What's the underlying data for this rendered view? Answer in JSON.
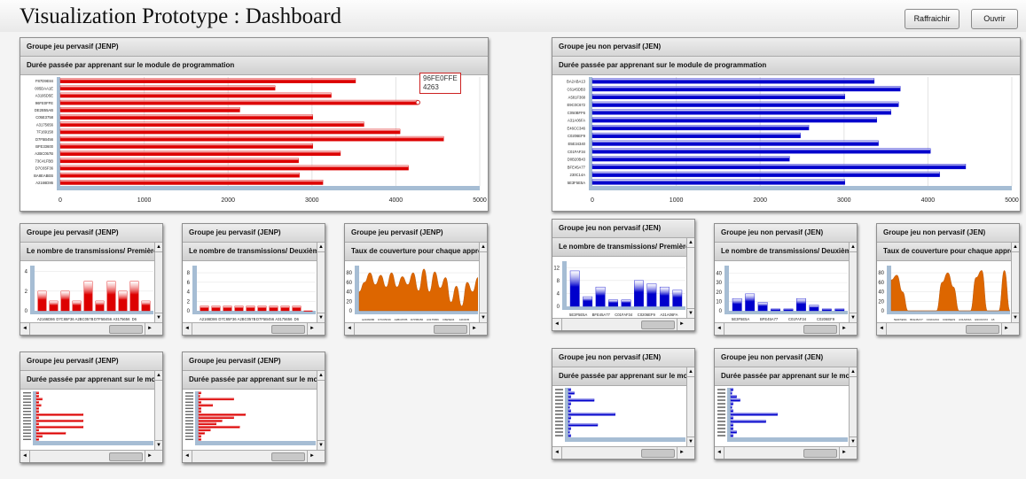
{
  "header": {
    "title": "Visualization Prototype : Dashboard",
    "refresh_label": "Raffraichir",
    "open_label": "Ouvrir"
  },
  "colors": {
    "red": "#dd0000",
    "blue": "#0000cc",
    "orange": "#dd6600",
    "axis": "#a6bdd4"
  },
  "panels": [
    {
      "title": "Groupe jeu pervasif (JENP)",
      "chart_title": "Durée passée par apprenant sur le module de programmation"
    },
    {
      "title": "Groupe jeu non pervasif (JEN)",
      "chart_title": "Durée passée par apprenant sur le module de programmation"
    },
    {
      "title": "Groupe jeu pervasif (JENP)",
      "chart_title": "Le nombre de transmissions/ Première"
    },
    {
      "title": "Groupe jeu pervasif (JENP)",
      "chart_title": "Le nombre de transmissions/ Deuxième"
    },
    {
      "title": "Groupe jeu pervasif (JENP)",
      "chart_title": "Taux de couverture pour chaque appren"
    },
    {
      "title": "Groupe jeu non pervasif (JEN)",
      "chart_title": "Le nombre de transmissions/ Première"
    },
    {
      "title": "Groupe jeu non pervasif (JEN)",
      "chart_title": "Le nombre de transmissions/ Deuxième"
    },
    {
      "title": "Groupe jeu non pervasif (JEN)",
      "chart_title": "Taux de couverture pour chaque appre"
    },
    {
      "title": "Groupe jeu pervasif (JENP)",
      "chart_title": "Durée passée par apprenant sur le mod"
    },
    {
      "title": "Groupe jeu pervasif (JENP)",
      "chart_title": "Durée passée par apprenant sur le mod"
    },
    {
      "title": "Groupe jeu non pervasif (JEN)",
      "chart_title": "Durée passée par apprenant sur le mo"
    },
    {
      "title": "Groupe jeu non pervasif (JEN)",
      "chart_title": "Durée passée par apprenant sur le mo"
    }
  ],
  "tooltip": {
    "line1": "96FE0FFE",
    "line2": "4263"
  },
  "chart_data": [
    {
      "type": "bar",
      "orientation": "horizontal",
      "color": "red",
      "categories": [
        "F87D9E84",
        "005DAA1E",
        "A3195D5E",
        "96FE0FFE",
        "DE2B55AB",
        "C05E3758",
        "A3175656",
        "7F169158",
        "D7F5B456",
        "BFE33600",
        "A2BC057B",
        "73C41FBB",
        "D7C65F36",
        "BA8EABEB",
        "A2166D86"
      ],
      "values": [
        3520,
        2560,
        3230,
        4263,
        2140,
        3010,
        3620,
        4050,
        4570,
        3010,
        3340,
        2840,
        4150,
        2850,
        3130
      ],
      "ticks": [
        0,
        1000,
        2000,
        3000,
        4000,
        5000
      ],
      "xlim": [
        0,
        5000
      ]
    },
    {
      "type": "bar",
      "orientation": "horizontal",
      "color": "blue",
      "categories": [
        "BA2ABA13",
        "C6145DB3",
        "A581F368",
        "E9C0C672",
        "C050BFF6",
        "A31A06FA",
        "E46CC346",
        "C0206EF9",
        "E5E34340",
        "C01FAF34",
        "D0B20B43",
        "BFE45A77",
        "230C14A",
        "5E3F5E5A"
      ],
      "values": [
        3360,
        3670,
        3010,
        3650,
        3560,
        3390,
        2580,
        2480,
        3410,
        4030,
        2350,
        4450,
        4140,
        3010
      ],
      "ticks": [
        0,
        1000,
        2000,
        3000,
        4000,
        5000
      ],
      "xlim": [
        0,
        5000
      ]
    },
    {
      "type": "bar",
      "color": "red",
      "yticks": [
        0,
        2,
        4
      ],
      "ylim": [
        0,
        4.6
      ],
      "xlabels": [
        "A2166D86",
        "D7C65F36",
        "A2BC057B",
        "D7F5B456",
        "A3175656",
        "D6"
      ],
      "values": [
        2,
        1,
        2,
        1,
        3,
        1,
        3,
        2,
        3,
        1
      ]
    },
    {
      "type": "bar",
      "color": "red",
      "yticks": [
        0,
        2,
        4,
        6,
        8
      ],
      "ylim": [
        0,
        9.5
      ],
      "xlabels": [
        "A2166D86",
        "D7C65F36",
        "A2BC057B",
        "D7F5B456",
        "A3175656",
        "D6"
      ],
      "values": [
        1,
        1,
        1,
        1,
        1,
        1,
        1,
        1,
        1,
        0
      ]
    },
    {
      "type": "area",
      "color": "orange",
      "yticks": [
        0,
        20,
        40,
        60,
        80
      ],
      "ylim": [
        0,
        95
      ],
      "xlabels": [
        "A2166D86",
        "D7C65F36",
        "A2BC057B",
        "D7F5B456",
        "A3175656",
        "D6E5E04",
        "A3C0FB"
      ],
      "values": [
        40,
        60,
        80,
        55,
        75,
        50,
        80,
        50,
        72,
        55,
        80,
        42,
        88,
        40,
        82,
        48,
        70,
        18,
        52,
        10,
        60,
        40,
        70
      ]
    },
    {
      "type": "bar",
      "color": "blue",
      "yticks": [
        0,
        4,
        8,
        12
      ],
      "ylim": [
        0,
        14
      ],
      "xlabels": [
        "5E3F5E5A",
        "BFE45A77",
        "C01FAF34",
        "C0206EF9",
        "A31A06FA"
      ],
      "values": [
        11,
        3,
        6,
        2,
        2,
        8,
        7,
        6,
        5
      ]
    },
    {
      "type": "bar",
      "color": "blue",
      "yticks": [
        0,
        10,
        20,
        30,
        40
      ],
      "ylim": [
        0,
        48
      ],
      "xlabels": [
        "5E3F5E5A",
        "BFE45A77",
        "C01FAF34",
        "C0206EF9"
      ],
      "values": [
        13,
        18,
        9,
        2,
        2,
        13,
        6,
        2,
        2
      ]
    },
    {
      "type": "area",
      "color": "orange",
      "yticks": [
        0,
        20,
        40,
        60,
        80
      ],
      "ylim": [
        0,
        95
      ],
      "xlabels": [
        "5E3F5E5A",
        "BFE45A77",
        "C01FAF34",
        "C0206EF9",
        "A31A06FA",
        "E9C0C672",
        "A5"
      ],
      "values": [
        65,
        75,
        40,
        0,
        0,
        0,
        0,
        0,
        0,
        60,
        80,
        50,
        0,
        0,
        0,
        70,
        85,
        0,
        0,
        0,
        85,
        0
      ]
    },
    {
      "type": "bar",
      "orientation": "horizontal",
      "color": "red",
      "values": [
        0.02,
        0.02,
        0.05,
        0.02,
        0.04,
        0.02,
        0.02,
        0.4,
        0.02,
        0.4,
        0.02,
        0.4,
        0.02,
        0.25,
        0.05,
        0.02
      ]
    },
    {
      "type": "bar",
      "orientation": "horizontal",
      "color": "red",
      "values": [
        0.02,
        0.01,
        0.3,
        0.02,
        0.12,
        0.02,
        0.02,
        0.4,
        0.3,
        0.2,
        0.15,
        0.35,
        0.1,
        0.05,
        0.02,
        0.02
      ]
    },
    {
      "type": "bar",
      "orientation": "horizontal",
      "color": "blue",
      "values": [
        0.02,
        0.05,
        0.02,
        0.22,
        0.02,
        0.01,
        0.02,
        0.4,
        0.02,
        0.01,
        0.25,
        0.02,
        0.01,
        0.02
      ]
    },
    {
      "type": "bar",
      "orientation": "horizontal",
      "color": "blue",
      "values": [
        0.02,
        0.01,
        0.05,
        0.08,
        0.02,
        0.01,
        0.02,
        0.4,
        0.02,
        0.3,
        0.02,
        0.02,
        0.05,
        0.02
      ]
    }
  ]
}
